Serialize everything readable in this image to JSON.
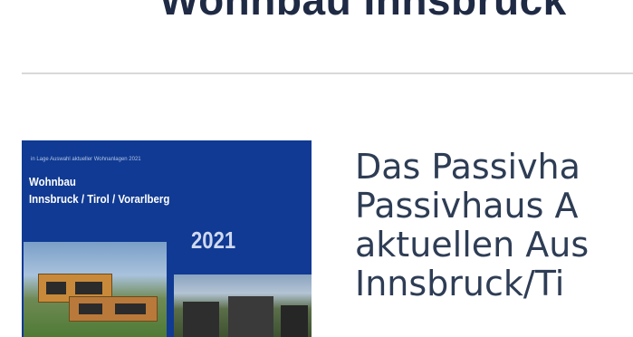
{
  "page": {
    "title": "Wohnbau Innsbruck"
  },
  "cover": {
    "small_text": "in Lage Auswahl aktueller Wohnanlagen 2021",
    "title_line_1": "Wohnbau",
    "title_line_2": "Innsbruck / Tirol / Vorarlberg",
    "year": "2021"
  },
  "intro": {
    "lines": [
      "Das Passivha",
      "Passivhaus A",
      "aktuellen Aus",
      "Innsbruck/Ti"
    ]
  }
}
